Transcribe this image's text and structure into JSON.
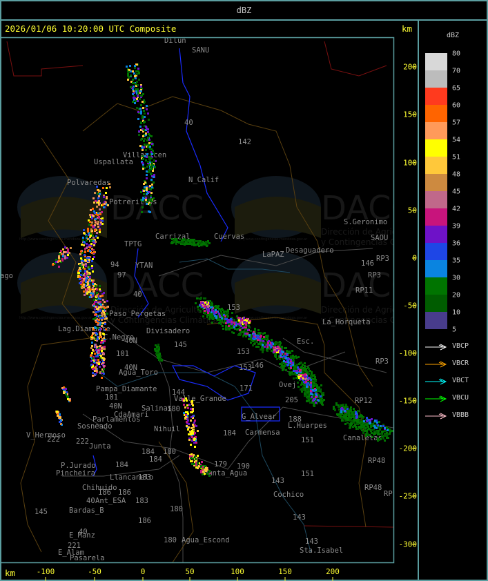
{
  "header": {
    "title": "dBZ"
  },
  "panel": {
    "timestamp": "2026/01/06 10:20:00 UTC Composite",
    "km_label_top": "km",
    "km_label_bottom": "km"
  },
  "x_axis": {
    "unit": "km",
    "ticks": [
      "-100",
      "-50",
      "0",
      "50",
      "100",
      "150",
      "200"
    ]
  },
  "y_axis": {
    "unit": "km",
    "ticks": [
      "200",
      "150",
      "100",
      "50",
      "0",
      "-50",
      "-100",
      "-150",
      "-200",
      "-250",
      "-300"
    ]
  },
  "legend": {
    "title": "dBZ",
    "labels": [
      "80",
      "70",
      "65",
      "60",
      "57",
      "54",
      "51",
      "48",
      "45",
      "42",
      "39",
      "36",
      "35",
      "30",
      "20",
      "10",
      "5"
    ],
    "colors": [
      "#d8d8d8",
      "#bcbcbc",
      "#ff3a1e",
      "#ff6400",
      "#ff9a5a",
      "#ffff00",
      "#ffc83a",
      "#cd8a40",
      "#c0688a",
      "#c8147c",
      "#6e12c8",
      "#1e46e6",
      "#0a84e0",
      "#007400",
      "#005c00",
      "#483c8c"
    ],
    "radars": [
      {
        "name": "VBCP",
        "color": "#ffffff"
      },
      {
        "name": "VBCR",
        "color": "#ffa500"
      },
      {
        "name": "VBCT",
        "color": "#00ffff"
      },
      {
        "name": "VBCU",
        "color": "#00ff00"
      },
      {
        "name": "VBBB",
        "color": "#ffc0cb"
      }
    ]
  },
  "watermark": {
    "logo": "DACC",
    "line1": "Dirección de Agricultura",
    "line2": "y Contingencias Climáticas",
    "url": "http://www.contingencias.mendoza.gov.ar"
  },
  "places": [
    "Dilun",
    "SANU",
    "142",
    "40",
    "Uspallata",
    "Villavicen",
    "N_Calif",
    "Polvaredas",
    "Potrerillos",
    "Carrizal",
    "Cuervas",
    "S.Geronimo",
    "SAOU",
    "Desaguadero",
    "LaPAZ",
    "146",
    "RP3",
    "RP3",
    "RP11",
    "TPTG",
    "YTAN",
    "94",
    "97",
    "ago",
    "40",
    "Paso_Pergetas",
    "Divisadero",
    "Lag.Diamante",
    "C.Negro",
    "40N",
    "153",
    "La_Horqueta",
    "Esc.",
    "145",
    "101",
    "40N",
    "Agua_Toro",
    "Pampa_Diamante",
    "101",
    "40N",
    "Salinas",
    "180",
    "CdaAmari",
    "Parlamentos",
    "Sosneado",
    "Nihuil",
    "V_Hermoso",
    "222",
    "222",
    "Junta",
    "P.Jurado",
    "Pincheira",
    "184",
    "184",
    "Llancanelo",
    "183",
    "Chihuido",
    "186",
    "186",
    "Ant_ESA",
    "183",
    "40",
    "180",
    "145",
    "Bardas_B",
    "186",
    "40",
    "E_Manz",
    "221",
    "E_Alam",
    "Pasarela",
    "180",
    "Agua_Escond",
    "Sta.Isabel",
    "143",
    "Cochico",
    "143",
    "143",
    "151",
    "151",
    "179",
    "190",
    "Punta_Agua",
    "184",
    "Carmensa",
    "188",
    "L.Huarpes",
    "205",
    "Ovej",
    "171",
    "153",
    "146",
    "153",
    "144",
    "Valle_Grande",
    "RP12",
    "Canaletas",
    "RP48",
    "RP48",
    "RP",
    "RP3",
    "G_Alvear",
    "184",
    "180"
  ]
}
